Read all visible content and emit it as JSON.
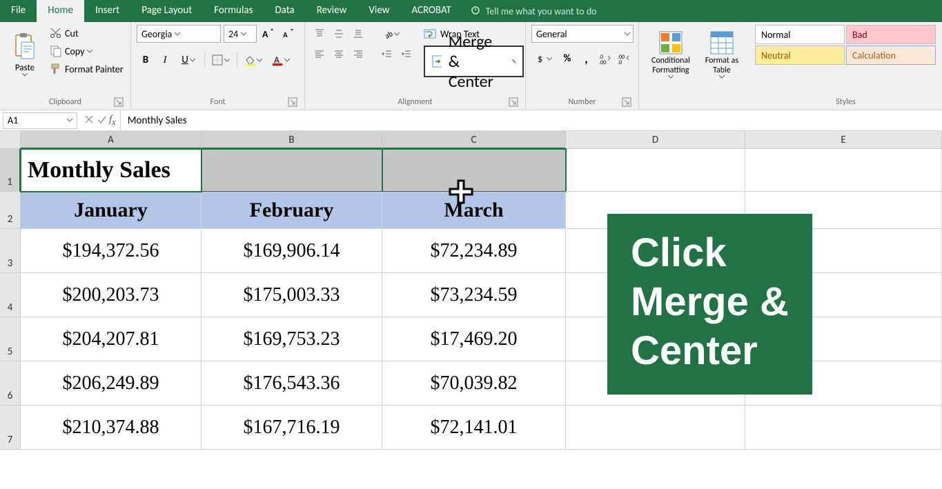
{
  "tabs": {
    "file": "File",
    "home": "Home",
    "insert": "Insert",
    "page_layout": "Page Layout",
    "formulas": "Formulas",
    "data": "Data",
    "review": "Review",
    "view": "View",
    "acrobat": "ACROBAT",
    "tell_me": "Tell me what you want to do"
  },
  "clipboard": {
    "paste": "Paste",
    "cut": "Cut",
    "copy": "Copy",
    "format_painter": "Format Painter",
    "label": "Clipboard"
  },
  "font": {
    "name": "Georgia",
    "size": "24",
    "label": "Font"
  },
  "alignment": {
    "wrap_text": "Wrap Text",
    "merge_center": "Merge & Center",
    "label": "Alignment"
  },
  "number": {
    "format": "General",
    "label": "Number"
  },
  "cond_fmt": "Conditional Formatting",
  "fmt_table": "Format as Table",
  "styles": {
    "normal": "Normal",
    "bad": "Bad",
    "neutral": "Neutral",
    "calculation": "Calculation",
    "label": "Styles"
  },
  "namebox": "A1",
  "formula": "Monthly Sales",
  "columns": [
    "A",
    "B",
    "C",
    "D",
    "E"
  ],
  "sheet": {
    "title": "Monthly Sales",
    "headers": [
      "January",
      "February",
      "March"
    ],
    "rows": [
      [
        "$194,372.56",
        "$169,906.14",
        "$72,234.89"
      ],
      [
        "$200,203.73",
        "$175,003.33",
        "$73,234.59"
      ],
      [
        "$204,207.81",
        "$169,753.23",
        "$17,469.20"
      ],
      [
        "$206,249.89",
        "$176,543.36",
        "$70,039.82"
      ],
      [
        "$210,374.88",
        "$167,716.19",
        "$72,141.01"
      ]
    ]
  },
  "rownums": [
    "1",
    "2",
    "3",
    "4",
    "5",
    "6",
    "7"
  ],
  "callout": {
    "line1": "Click",
    "line2": "Merge &",
    "line3": "Center"
  }
}
